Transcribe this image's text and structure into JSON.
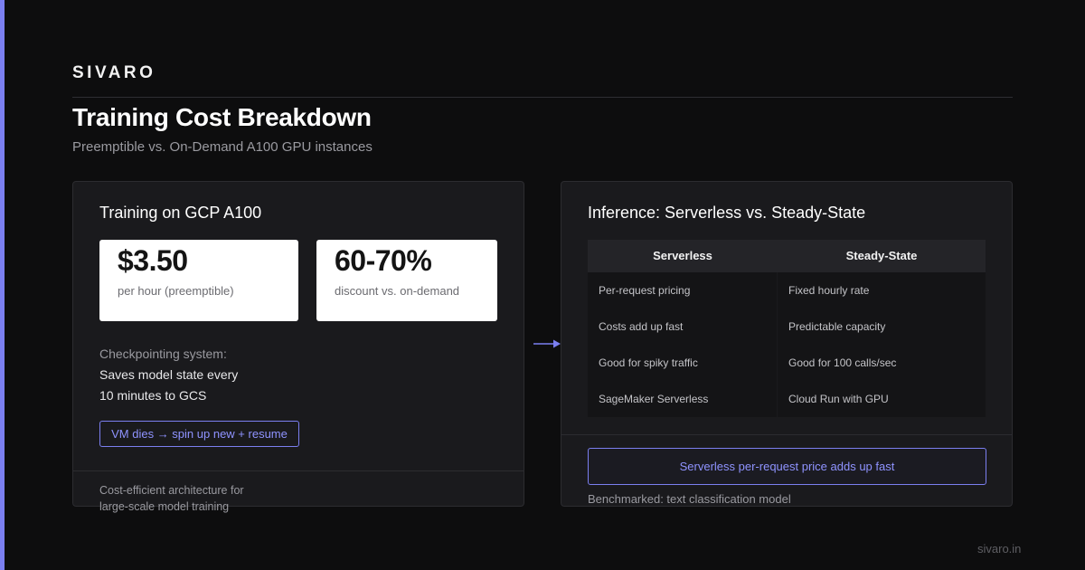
{
  "brand": "SIVARO",
  "header": {
    "title": "Training Cost Breakdown",
    "subtitle": "Preemptible vs. On-Demand A100 GPU instances"
  },
  "left_panel": {
    "title": "Training on GCP A100",
    "stats": [
      {
        "value": "$3.50",
        "label": "per hour (preemptible)"
      },
      {
        "value": "60-70%",
        "label": "discount vs. on-demand"
      }
    ],
    "checkpoint_label": "Checkpointing system:",
    "checkpoint_lines": [
      "Saves model state every",
      "10 minutes to GCS"
    ],
    "resume_pill": "VM dies → spin up new + resume",
    "footer_lines": [
      "Cost-efficient architecture for",
      "large-scale model training"
    ]
  },
  "right_panel": {
    "title": "Inference: Serverless vs. Steady-State",
    "table": {
      "headers": [
        "Serverless",
        "Steady-State"
      ],
      "rows": [
        [
          "Per-request pricing",
          "Fixed hourly rate"
        ],
        [
          "Costs add up fast",
          "Predictable capacity"
        ],
        [
          "Good for spiky traffic",
          "Good for 100 calls/sec"
        ],
        [
          "SageMaker Serverless",
          "Cloud Run with GPU"
        ]
      ]
    },
    "callout": "Serverless per-request price adds up fast",
    "footer": "Benchmarked: text classification model"
  },
  "site": "sivaro.in",
  "colors": {
    "accent": "#7b7ff0",
    "background": "#0d0d0e",
    "panel": "#1a1a1d"
  },
  "icons": {
    "flow_arrow": "right-arrow-icon"
  }
}
